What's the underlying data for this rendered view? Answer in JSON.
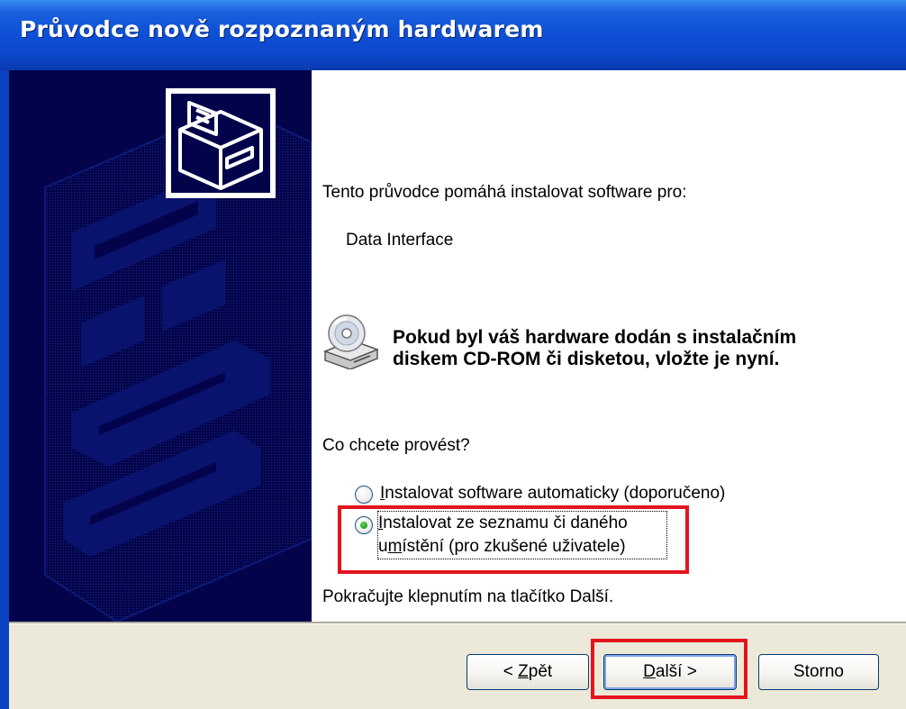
{
  "window": {
    "title": "Průvodce nově rozpoznaným hardwarem"
  },
  "icons": {
    "hardware": "hardware-device-icon",
    "cd": "cd-drive-icon"
  },
  "content": {
    "intro": "Tento průvodce pomáhá instalovat software pro:",
    "device_name": "Data Interface",
    "cd_prompt": "Pokud byl váš hardware dodán s instalačním diskem CD-ROM či disketou, vložte je nyní.",
    "question": "Co chcete provést?",
    "option_auto": {
      "label_underlined": "I",
      "label_rest": "nstalovat software automaticky (doporučeno)",
      "selected": false
    },
    "option_list": {
      "line1_underlined": "I",
      "line1_rest": "nstalovat ze seznamu či daného",
      "line2_pre": "u",
      "line2_underlined": "m",
      "line2_rest": "ístění (pro zkušené uživatele)",
      "selected": true
    },
    "continue_hint": "Pokračujte klepnutím na tlačítko Další."
  },
  "buttons": {
    "back": {
      "pre": "< ",
      "underlined": "Z",
      "rest": "pět"
    },
    "next": {
      "underlined": "D",
      "rest": "alší >"
    },
    "cancel": "Storno"
  },
  "colors": {
    "titlebar": "#0c47c9",
    "left_panel": "#02034a",
    "highlight_box": "#e4141d",
    "button_bar": "#ece9d8"
  }
}
